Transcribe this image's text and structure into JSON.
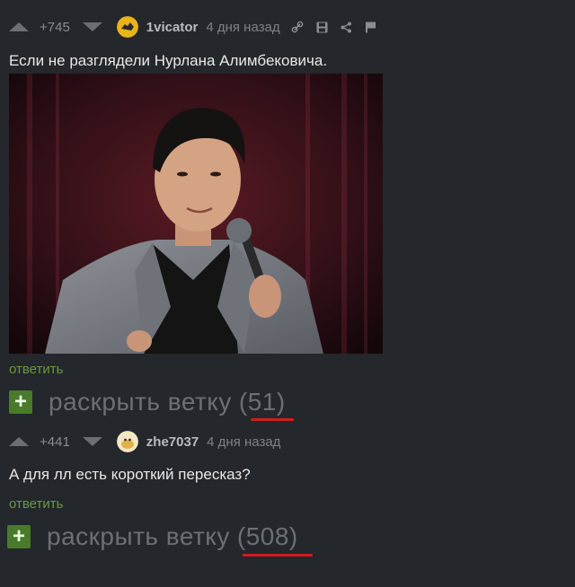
{
  "comments": [
    {
      "rating": "+745",
      "username": "1vicator",
      "time": "4 дня назад",
      "text": "Если не разглядели Нурлана Алимбековича.",
      "reply": "ответить",
      "expand_label": "раскрыть ветку",
      "expand_count": "(51)",
      "actions": [
        "link-icon",
        "save-icon",
        "share-icon",
        "flag-icon"
      ]
    },
    {
      "rating": "+441",
      "username": "zhe7037",
      "time": "4 дня назад",
      "text": "А для лл есть короткий пересказ?",
      "reply": "ответить",
      "expand_label": "раскрыть ветку",
      "expand_count": "(508)"
    }
  ],
  "colors": {
    "background": "#24272b",
    "reply_link": "#6a9a3f",
    "expand_button": "#4a7a2c",
    "underline": "#d11d1d"
  }
}
